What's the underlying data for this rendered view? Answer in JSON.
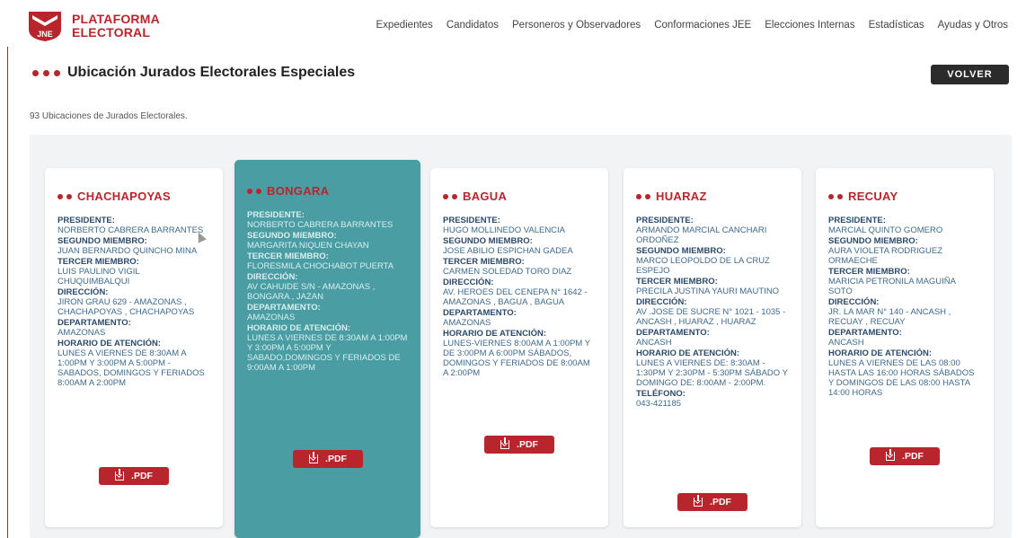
{
  "brand": {
    "line1": "PLATAFORMA",
    "line2": "ELECTORAL",
    "logo_text": "JNE",
    "color": "#b9252c"
  },
  "nav": [
    "Expedientes",
    "Candidatos",
    "Personeros y Observadores",
    "Conformaciones JEE",
    "Elecciones Internas",
    "Estadísticas",
    "Ayudas y Otros"
  ],
  "page": {
    "title": "Ubicación Jurados Electorales Especiales",
    "back_label": "VOLVER",
    "count_text": "93 Ubicaciones de Jurados Electorales."
  },
  "cards": [
    {
      "name": "CHACHAPOYAS",
      "fields": [
        {
          "label": "PRESIDENTE:",
          "value": "NORBERTO CABRERA BARRANTES"
        },
        {
          "label": "SEGUNDO MIEMBRO:",
          "value": "JUAN BERNARDO QUINCHO MINA"
        },
        {
          "label": "TERCER MIEMBRO:",
          "value": "LUIS PAULINO VIGIL CHUQUIMBALQUI"
        },
        {
          "label": "DIRECCIÓN:",
          "value": "JIRON GRAU 629 - AMAZONAS , CHACHAPOYAS , CHACHAPOYAS"
        },
        {
          "label": "DEPARTAMENTO:",
          "value": "AMAZONAS"
        },
        {
          "label": "HORARIO DE ATENCIÓN:",
          "value": "LUNES A VIERNES DE 8:30AM A 1:00PM Y 3:00PM A 5:00PM - SABADOS, DOMINGOS Y FERIADOS 8:00AM A 2:00PM"
        }
      ],
      "pdf_label": ".PDF"
    },
    {
      "name": "BONGARA",
      "fields": [
        {
          "label": "PRESIDENTE:",
          "value": "NORBERTO CABRERA BARRANTES"
        },
        {
          "label": "SEGUNDO MIEMBRO:",
          "value": "MARGARITA NIQUEN CHAYAN"
        },
        {
          "label": "TERCER MIEMBRO:",
          "value": "FLORESMILA CHOCHABOT PUERTA"
        },
        {
          "label": "DIRECCIÓN:",
          "value": "AV CAHUIDE S/N - AMAZONAS , BONGARA , JAZAN"
        },
        {
          "label": "DEPARTAMENTO:",
          "value": "AMAZONAS"
        },
        {
          "label": "HORARIO DE ATENCIÓN:",
          "value": "LUNES A VIERNES DE 8:30AM A 1:00PM Y 3:00PM A 5:00PM Y SABADO,DOMINGOS Y FERIADOS DE 9:00AM A 1:00PM"
        }
      ],
      "pdf_label": ".PDF"
    },
    {
      "name": "BAGUA",
      "fields": [
        {
          "label": "PRESIDENTE:",
          "value": "HUGO MOLLINEDO VALENCIA"
        },
        {
          "label": "SEGUNDO MIEMBRO:",
          "value": "JOSE ABILIO ESPICHAN GADEA"
        },
        {
          "label": "TERCER MIEMBRO:",
          "value": "CARMEN SOLEDAD TORO DIAZ"
        },
        {
          "label": "DIRECCIÓN:",
          "value": "AV. HEROES DEL CENEPA N° 1642 - AMAZONAS , BAGUA , BAGUA"
        },
        {
          "label": "DEPARTAMENTO:",
          "value": "AMAZONAS"
        },
        {
          "label": "HORARIO DE ATENCIÓN:",
          "value": "LUNES-VIERNES 8:00AM A 1:00PM Y DE 3:00PM A 6:00PM SÁBADOS, DOMINGOS Y FERIADOS DE 8:00AM A 2:00PM"
        }
      ],
      "pdf_label": ".PDF"
    },
    {
      "name": "HUARAZ",
      "fields": [
        {
          "label": "PRESIDENTE:",
          "value": "ARMANDO MARCIAL CANCHARI ORDOÑEZ"
        },
        {
          "label": "SEGUNDO MIEMBRO:",
          "value": "MARCO LEOPOLDO DE LA CRUZ ESPEJO"
        },
        {
          "label": "TERCER MIEMBRO:",
          "value": "PRECILA JUSTINA YAURI MAUTINO"
        },
        {
          "label": "DIRECCIÓN:",
          "value": "AV .JOSE DE SUCRE N° 1021 - 1035 - ANCASH , HUARAZ , HUARAZ"
        },
        {
          "label": "DEPARTAMENTO:",
          "value": "ANCASH"
        },
        {
          "label": "HORARIO DE ATENCIÓN:",
          "value": "LUNES A VIERNES DE: 8:30AM - 1:30PM Y 2:30PM - 5:30PM SÁBADO Y DOMINGO DE: 8:00AM - 2:00PM."
        },
        {
          "label": "TELÉFONO:",
          "value": "043-421185"
        }
      ],
      "pdf_label": ".PDF"
    },
    {
      "name": "RECUAY",
      "fields": [
        {
          "label": "PRESIDENTE:",
          "value": "MARCIAL QUINTO GOMERO"
        },
        {
          "label": "SEGUNDO MIEMBRO:",
          "value": "AURA VIOLETA RODRIGUEZ ORMAECHE"
        },
        {
          "label": "TERCER MIEMBRO:",
          "value": "MARICIA PETRONILA MAGUIÑA SOTO"
        },
        {
          "label": "DIRECCIÓN:",
          "value": "JR. LA MAR N° 140 - ANCASH , RECUAY , RECUAY"
        },
        {
          "label": "DEPARTAMENTO:",
          "value": "ANCASH"
        },
        {
          "label": "HORARIO DE ATENCIÓN:",
          "value": "LUNES A VIERNES DE LAS 08:00 HASTA LAS 16:00 HORAS SÁBADOS Y DOMINGOS DE LAS 08:00 HASTA 14:00 HORAS"
        }
      ],
      "pdf_label": ".PDF"
    }
  ]
}
